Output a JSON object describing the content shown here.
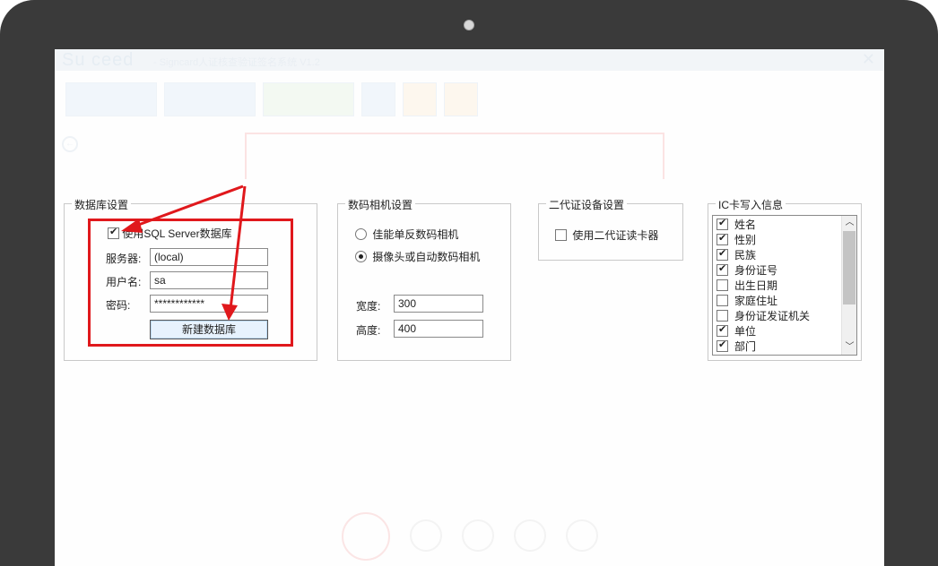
{
  "background_app": {
    "logo": "Su  ceed",
    "title": "- Signcard人证核查验证签名系统 V1.2",
    "close_glyph": "✕"
  },
  "database_settings": {
    "title": "数据库设置",
    "use_sql_server": {
      "label": "使用SQL Server数据库",
      "checked": true
    },
    "server": {
      "label": "服务器:",
      "value": "(local)"
    },
    "username": {
      "label": "用户名:",
      "value": "sa"
    },
    "password": {
      "label": "密码:",
      "value": "************"
    },
    "create_button": "新建数据库"
  },
  "camera_settings": {
    "title": "数码相机设置",
    "options": [
      {
        "label": "佳能单反数码相机",
        "selected": false
      },
      {
        "label": "摄像头或自动数码相机",
        "selected": true
      }
    ],
    "width": {
      "label": "宽度:",
      "value": "300"
    },
    "height": {
      "label": "高度:",
      "value": "400"
    }
  },
  "id_device_settings": {
    "title": "二代证设备设置",
    "use_reader": {
      "label": "使用二代证读卡器",
      "checked": false
    }
  },
  "ic_card_info": {
    "title": "IC卡写入信息",
    "items": [
      {
        "label": "姓名",
        "checked": true
      },
      {
        "label": "性别",
        "checked": true
      },
      {
        "label": "民族",
        "checked": true
      },
      {
        "label": "身份证号",
        "checked": true
      },
      {
        "label": "出生日期",
        "checked": false
      },
      {
        "label": "家庭住址",
        "checked": false
      },
      {
        "label": "身份证发证机关",
        "checked": false
      },
      {
        "label": "单位",
        "checked": true
      },
      {
        "label": "部门",
        "checked": true
      }
    ]
  },
  "colors": {
    "highlight": "#e0181c",
    "button_bg": "#e7f2fd"
  },
  "icons": {
    "scroll_up": "chevron-up-icon",
    "scroll_down": "chevron-down-icon",
    "check": "check-icon"
  }
}
